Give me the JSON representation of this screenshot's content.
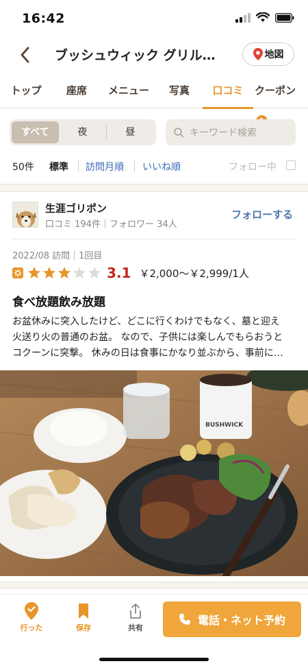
{
  "status": {
    "time": "16:42"
  },
  "nav": {
    "title": "ブッシュウィック グリル…",
    "map_label": "地図"
  },
  "tabs": [
    {
      "label": "トップ"
    },
    {
      "label": "座席"
    },
    {
      "label": "メニュー"
    },
    {
      "label": "写真"
    },
    {
      "label": "口コミ",
      "active": true
    },
    {
      "label": "クーポン",
      "badge": "1"
    }
  ],
  "filter": {
    "segments": [
      "すべて",
      "夜",
      "昼"
    ],
    "active_segment": "すべて",
    "search_placeholder": "キーワード検索"
  },
  "sort": {
    "count": "50件",
    "options": [
      "標準",
      "訪問月順",
      "いいね順"
    ],
    "active": "標準",
    "follow_only": "フォロー中"
  },
  "review": {
    "user_name": "生涯ゴリポン",
    "user_meta": "口コミ 194件｜フォロワー 34人",
    "follow_label": "フォローする",
    "visit": "2022/08 訪問｜1回目",
    "rating": "3.1",
    "rating_value": 3.1,
    "price": "￥2,000～￥2,999/1人",
    "title": "食べ放題飲み放題",
    "body_lines": [
      "お盆休みに突入したけど、どこに行くわけでもなく、墓と迎え",
      "火送り火の普通のお盆。 なので、子供には楽しんでもらおうと",
      "コクーンに突撃。 休みの日は食事にかなり並ぶから、事前に…"
    ],
    "photo_label": "BUSHWICK"
  },
  "bottom": {
    "went": "行った",
    "save": "保存",
    "share": "共有",
    "reserve": "電話・ネット予約"
  },
  "colors": {
    "accent": "#e8952a",
    "link": "#3a6ab8",
    "score": "#c4261d",
    "reserve_button": "#f0a63b"
  }
}
